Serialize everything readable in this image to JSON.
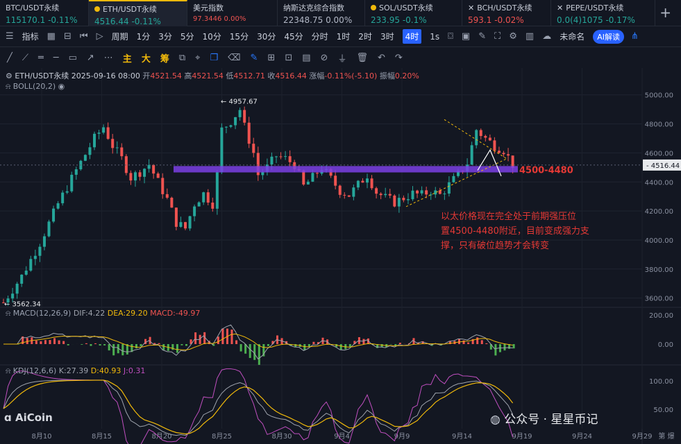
{
  "tickers": [
    {
      "name": "BTC/USDT永续",
      "price": "115170.1",
      "change": "-0.11%",
      "trend": "up",
      "icon": "none"
    },
    {
      "name": "ETH/USDT永续",
      "price": "4516.44",
      "change": "-0.11%",
      "trend": "up",
      "icon": "dot",
      "active": true
    },
    {
      "name": "美元指数",
      "price": "97.3446",
      "change": "0.00%",
      "trend": "dn",
      "icon": "none"
    },
    {
      "name": "纳斯达克综合指数",
      "price": "22348.75",
      "change": "0.00%",
      "trend": "neutral",
      "icon": "none"
    },
    {
      "name": "SOL/USDT永续",
      "price": "233.95",
      "change": "-0.1%",
      "trend": "up",
      "icon": "dot"
    },
    {
      "name": "BCH/USDT永续",
      "price": "593.1",
      "change": "-0.02%",
      "trend": "dn",
      "icon": "x"
    },
    {
      "name": "PEPE/USDT永续",
      "price": "0.0(4)1075",
      "change": "-0.17%",
      "trend": "up",
      "icon": "x"
    }
  ],
  "toolbar": {
    "indicator_label": "指标",
    "period_label": "周期",
    "intervals": [
      "1分",
      "3分",
      "5分",
      "10分",
      "15分",
      "30分",
      "45分",
      "分时",
      "1时",
      "2时",
      "3时",
      "4时",
      "1s"
    ],
    "selected_interval": "4时",
    "unnamed_label": "未命名",
    "ai_label": "AI解读"
  },
  "drawbar": {
    "main": "主",
    "large": "大",
    "chip": "筹"
  },
  "ohlc": {
    "symbol": "ETH/USDT永续",
    "datetime": "2025-09-16 08:00",
    "open_label": "开",
    "open": "4521.54",
    "high_label": "高",
    "high": "4521.54",
    "low_label": "低",
    "low": "4512.71",
    "close_label": "收",
    "close": "4516.44",
    "change_label": "涨幅",
    "change": "-0.11%(-5.10)",
    "amp_label": "振幅",
    "amp": "0.20%"
  },
  "boll_label": "BOLL(20,2)",
  "macd": {
    "label": "MACD(12,26,9)",
    "dif": "DIF:4.22",
    "dea": "DEA:29.20",
    "macd": "MACD:-49.97"
  },
  "kdj": {
    "label": "KDJ(12,6,6)",
    "k": "K:27.39",
    "d": "D:40.93",
    "j": "J:0.31"
  },
  "colors": {
    "up": "#26a69a",
    "down": "#ef5350",
    "support_band": "#7b3fe4",
    "dif": "#9ea3ad",
    "dea": "#f0b90b",
    "k": "#9ea3ad",
    "d": "#f0b90b",
    "j": "#c04fc0",
    "annotation": "#e53935"
  },
  "chart_data": {
    "type": "candlestick",
    "y_ticks": [
      "5000.00",
      "4800.00",
      "4600.00",
      "4400.00",
      "4200.00",
      "4000.00",
      "3800.00",
      "3600.00"
    ],
    "ylim": [
      3560,
      5080
    ],
    "current_price": "4516.44",
    "x_ticks": [
      "8月10",
      "8月15",
      "8月20",
      "8月25",
      "8月30",
      "9月4",
      "9月9",
      "9月14",
      "9月19",
      "9月24",
      "9月29"
    ],
    "x_extra": "第 爆",
    "high_marker": "4957.67",
    "low_marker": "3562.34",
    "support_band": {
      "label": "4500-4480",
      "top": 4500,
      "bottom": 4480
    },
    "annotation": [
      "以太价格现在完全处于前期强压位",
      "置4500-4480附近，目前变成强力支",
      "撑，只有破位趋势才会转变"
    ],
    "close_path": [
      [
        0,
        3570
      ],
      [
        4,
        3750
      ],
      [
        8,
        3980
      ],
      [
        12,
        4250
      ],
      [
        16,
        4480
      ],
      [
        20,
        4700
      ],
      [
        22,
        4780
      ],
      [
        24,
        4650
      ],
      [
        26,
        4560
      ],
      [
        28,
        4430
      ],
      [
        30,
        4470
      ],
      [
        32,
        4520
      ],
      [
        34,
        4400
      ],
      [
        36,
        4280
      ],
      [
        38,
        4120
      ],
      [
        40,
        4080
      ],
      [
        42,
        4250
      ],
      [
        44,
        4320
      ],
      [
        46,
        4250
      ],
      [
        47,
        4450
      ],
      [
        48,
        4760
      ],
      [
        50,
        4820
      ],
      [
        52,
        4900
      ],
      [
        53,
        4780
      ],
      [
        55,
        4600
      ],
      [
        56,
        4450
      ],
      [
        58,
        4500
      ],
      [
        60,
        4580
      ],
      [
        62,
        4560
      ],
      [
        64,
        4520
      ],
      [
        66,
        4370
      ],
      [
        68,
        4430
      ],
      [
        70,
        4500
      ],
      [
        72,
        4420
      ],
      [
        74,
        4340
      ],
      [
        76,
        4310
      ],
      [
        78,
        4380
      ],
      [
        80,
        4450
      ],
      [
        82,
        4330
      ],
      [
        84,
        4290
      ],
      [
        86,
        4260
      ],
      [
        88,
        4290
      ],
      [
        90,
        4320
      ],
      [
        92,
        4310
      ],
      [
        94,
        4340
      ],
      [
        96,
        4310
      ],
      [
        98,
        4380
      ],
      [
        100,
        4450
      ],
      [
        102,
        4530
      ],
      [
        104,
        4760
      ],
      [
        106,
        4700
      ],
      [
        108,
        4650
      ],
      [
        110,
        4620
      ],
      [
        112,
        4520
      ]
    ],
    "macd_yticks": [
      "200.00",
      "0.00"
    ],
    "kdj_yticks": [
      "100.00",
      "50.00"
    ]
  },
  "watermark": {
    "logo": "AiCoin",
    "wechat": "公众号 · 星星币记"
  }
}
